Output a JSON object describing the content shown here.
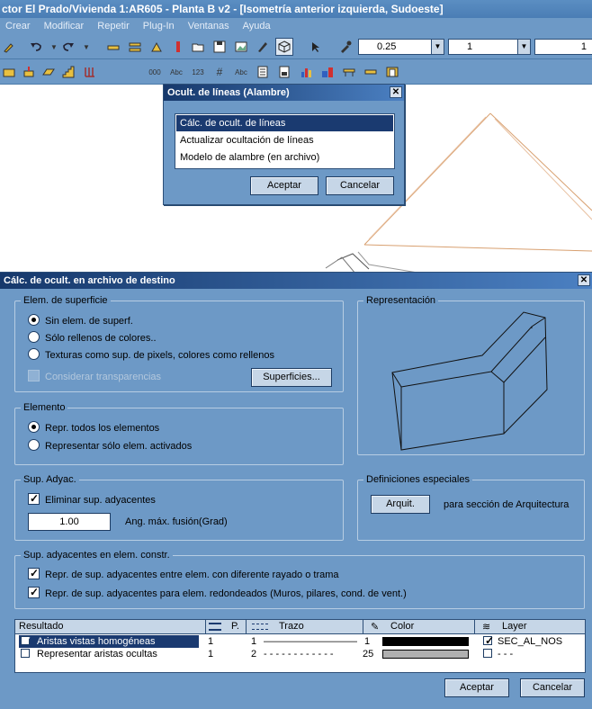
{
  "window": {
    "title": "ctor El Prado/Vivienda 1:AR605 - Planta B v2 - [Isometría anterior izquierda, Sudoeste]"
  },
  "menu": [
    "Crear",
    "Modificar",
    "Repetir",
    "Plug-In",
    "Ventanas",
    "Ayuda"
  ],
  "toolbar": {
    "pen_thickness": "0.25",
    "line_type": "1",
    "line_extra": "1"
  },
  "hidden_line_dialog": {
    "title": "Ocult. de líneas (Alambre)",
    "options": [
      "Cálc. de ocult. de líneas",
      "Actualizar ocultación de líneas",
      "Modelo de alambre (en archivo)"
    ],
    "ok": "Aceptar",
    "cancel": "Cancelar"
  },
  "main_dialog": {
    "title": "Cálc. de ocult. en archivo de destino",
    "surface": {
      "label": "Elem. de superficie",
      "opt1": "Sin elem. de superf.",
      "opt2": "Sólo rellenos de colores..",
      "opt3": "Texturas como sup. de pixels, colores como rellenos",
      "transparency": "Considerar transparencias",
      "surfaces_btn": "Superficies..."
    },
    "representation": {
      "label": "Representación"
    },
    "element": {
      "label": "Elemento",
      "opt1": "Repr. todos los elementos",
      "opt2": "Representar sólo elem. activados"
    },
    "adjacent": {
      "label": "Sup. Adyac.",
      "remove": "Eliminar sup. adyacentes",
      "angle_value": "1.00",
      "angle_label": "Ang. máx. fusión(Grad)"
    },
    "special": {
      "label": "Definiciones especiales",
      "arch_btn": "Arquit.",
      "arch_text": "para sección de Arquitectura"
    },
    "constr": {
      "label": "Sup. adyacentes en elem. constr.",
      "opt1": "Repr. de sup. adyacentes entre elem. con diferente rayado o trama",
      "opt2": "Repr. de sup. adyacentes para elem. redondeados (Muros, pilares, cond. de vent.)"
    },
    "table": {
      "headers": {
        "result": "Resultado",
        "pen": "P.",
        "line": "Trazo",
        "color": "Color",
        "layer": "Layer"
      },
      "rows": [
        {
          "name": "Aristas vistas homogéneas",
          "pen": "1",
          "line_num": "1",
          "line_style": "————————————",
          "color_num": "1",
          "color": "#000000",
          "layer": "SEC_AL_NOS"
        },
        {
          "name": "Representar aristas ocultas",
          "pen": "1",
          "line_num": "2",
          "line_style": "- - - - - - - - - - - -",
          "color_num": "25",
          "color": "#b0b0b0",
          "layer": "- - -"
        }
      ]
    },
    "ok": "Aceptar",
    "cancel": "Cancelar"
  }
}
